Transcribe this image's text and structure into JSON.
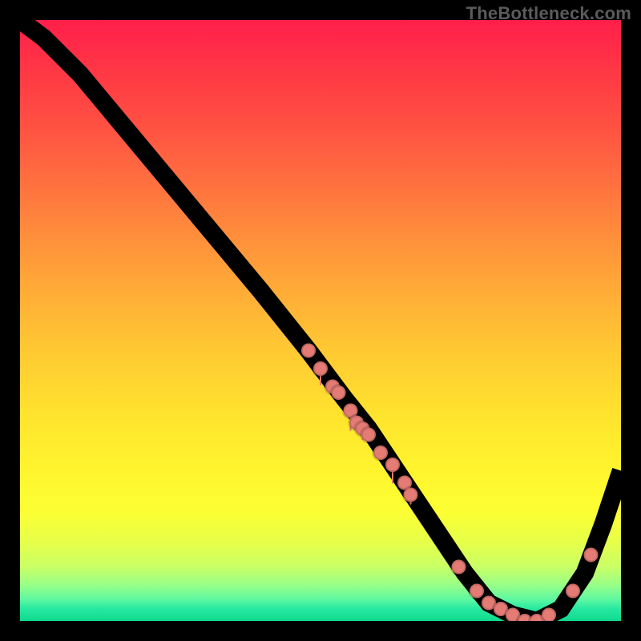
{
  "attribution": "TheBottleneck.com",
  "colors": {
    "dot": "#e47b74",
    "curve": "#000000",
    "gradient_top": "#ff1e4a",
    "gradient_bottom": "#0fd98e"
  },
  "chart_data": {
    "type": "line",
    "title": "",
    "xlabel": "",
    "ylabel": "",
    "xlim": [
      0,
      100
    ],
    "ylim": [
      0,
      100
    ],
    "grid": false,
    "legend": false,
    "series": [
      {
        "name": "curve",
        "x": [
          0,
          4,
          10,
          20,
          30,
          40,
          48,
          54,
          58,
          62,
          66,
          70,
          74,
          78,
          82,
          86,
          90,
          94,
          97,
          100
        ],
        "y": [
          100,
          97,
          91,
          79,
          67,
          55,
          45,
          37,
          32,
          26,
          20,
          14,
          8,
          3,
          1,
          0,
          2,
          8,
          16,
          25
        ]
      }
    ],
    "points": [
      {
        "x": 48,
        "y": 45
      },
      {
        "x": 50,
        "y": 42
      },
      {
        "x": 52,
        "y": 39
      },
      {
        "x": 53,
        "y": 38
      },
      {
        "x": 55,
        "y": 35
      },
      {
        "x": 56,
        "y": 33
      },
      {
        "x": 57,
        "y": 32
      },
      {
        "x": 58,
        "y": 31
      },
      {
        "x": 60,
        "y": 28
      },
      {
        "x": 62,
        "y": 26
      },
      {
        "x": 64,
        "y": 23
      },
      {
        "x": 65,
        "y": 21
      },
      {
        "x": 73,
        "y": 9
      },
      {
        "x": 76,
        "y": 5
      },
      {
        "x": 78,
        "y": 3
      },
      {
        "x": 80,
        "y": 2
      },
      {
        "x": 82,
        "y": 1
      },
      {
        "x": 84,
        "y": 0
      },
      {
        "x": 86,
        "y": 0
      },
      {
        "x": 88,
        "y": 1
      },
      {
        "x": 92,
        "y": 5
      },
      {
        "x": 95,
        "y": 11
      }
    ],
    "drips": [
      {
        "x": 50,
        "len": 3
      },
      {
        "x": 52,
        "len": 2
      },
      {
        "x": 55,
        "len": 4
      },
      {
        "x": 57,
        "len": 3
      },
      {
        "x": 60,
        "len": 2
      },
      {
        "x": 62,
        "len": 3
      },
      {
        "x": 65,
        "len": 2
      }
    ]
  }
}
